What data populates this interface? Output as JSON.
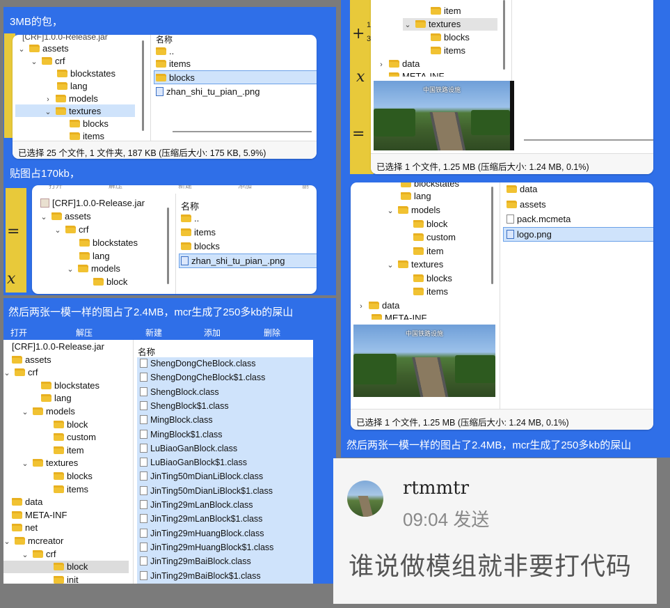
{
  "captions": {
    "top_left": "3MB的包，",
    "mid_left": "贴图占170kb，",
    "left_bottom": "然后两张一模一样的图占了2.4MB，mcr生成了250多kb的屎山",
    "right_bottom": "然后两张一模一样的图占了2.4MB，mcr生成了250多kb的屎山"
  },
  "win1": {
    "tree": [
      "[CRF]1.0.0-Release.jar",
      "assets",
      "crf",
      "blockstates",
      "lang",
      "models",
      "textures",
      "blocks",
      "items"
    ],
    "list": [
      "..",
      "items",
      "blocks",
      "zhan_shi_tu_pian_.png"
    ],
    "col_header": "名称",
    "status": "已选择 25 个文件, 1 文件夹, 187 KB (压缩后大小: 175 KB, 5.9%)"
  },
  "win2": {
    "top_labels": [
      "打开",
      "解压",
      "新建",
      "添加",
      "删"
    ],
    "tree": [
      "[CRF]1.0.0-Release.jar",
      "assets",
      "crf",
      "blockstates",
      "lang",
      "models",
      "block"
    ],
    "col_header": "名称",
    "list": [
      "..",
      "items",
      "blocks",
      "zhan_shi_tu_pian_.png"
    ]
  },
  "win3": {
    "toolbar": [
      "打开",
      "解压",
      "新建",
      "添加",
      "删除"
    ],
    "tree": [
      "[CRF]1.0.0-Release.jar",
      "assets",
      "crf",
      "blockstates",
      "lang",
      "models",
      "block",
      "custom",
      "item",
      "textures",
      "blocks",
      "items",
      "data",
      "META-INF",
      "net",
      "mcreator",
      "crf",
      "block",
      "init"
    ],
    "col_header": "名称",
    "files": [
      "ShengDongCheBlock.class",
      "ShengDongCheBlock$1.class",
      "ShengBlock.class",
      "ShengBlock$1.class",
      "MingBlock.class",
      "MingBlock$1.class",
      "LuBiaoGanBlock.class",
      "LuBiaoGanBlock$1.class",
      "JinTing50mDianLiBlock.class",
      "JinTing50mDianLiBlock$1.class",
      "JinTing29mLanBlock.class",
      "JinTing29mLanBlock$1.class",
      "JinTing29mHuangBlock.class",
      "JinTing29mHuangBlock$1.class",
      "JinTing29mBaiBlock.class",
      "JinTing29mBaiBlock$1.class"
    ]
  },
  "win4": {
    "tree": [
      "item",
      "textures",
      "blocks",
      "items",
      "data",
      "META-INF"
    ],
    "preview_label": "中国铁路设施",
    "status": "已选择 1 个文件, 1.25 MB (压缩后大小: 1.24 MB, 0.1%)"
  },
  "win5": {
    "tree": [
      "blockstates",
      "lang",
      "models",
      "block",
      "custom",
      "item",
      "textures",
      "blocks",
      "items",
      "data",
      "META-INF"
    ],
    "list": [
      "data",
      "assets",
      "pack.mcmeta",
      "logo.png"
    ],
    "preview_label": "中国铁路设施",
    "status": "已选择 1 个文件, 1.25 MB (压缩后大小: 1.24 MB, 0.1%)"
  },
  "chat": {
    "username": "rtmmtr",
    "time": "09:04",
    "sent": "发送",
    "message": "谁说做模组就非要打代码"
  },
  "math": {
    "plus": "+",
    "x": "x",
    "eq": "=",
    "one": "1",
    "frac_top": "1",
    "frac_bottom": "3"
  },
  "colors": {
    "panel_blue": "#2f6fe8",
    "selection": "#cfe3fb",
    "folder": "#f1c232"
  }
}
